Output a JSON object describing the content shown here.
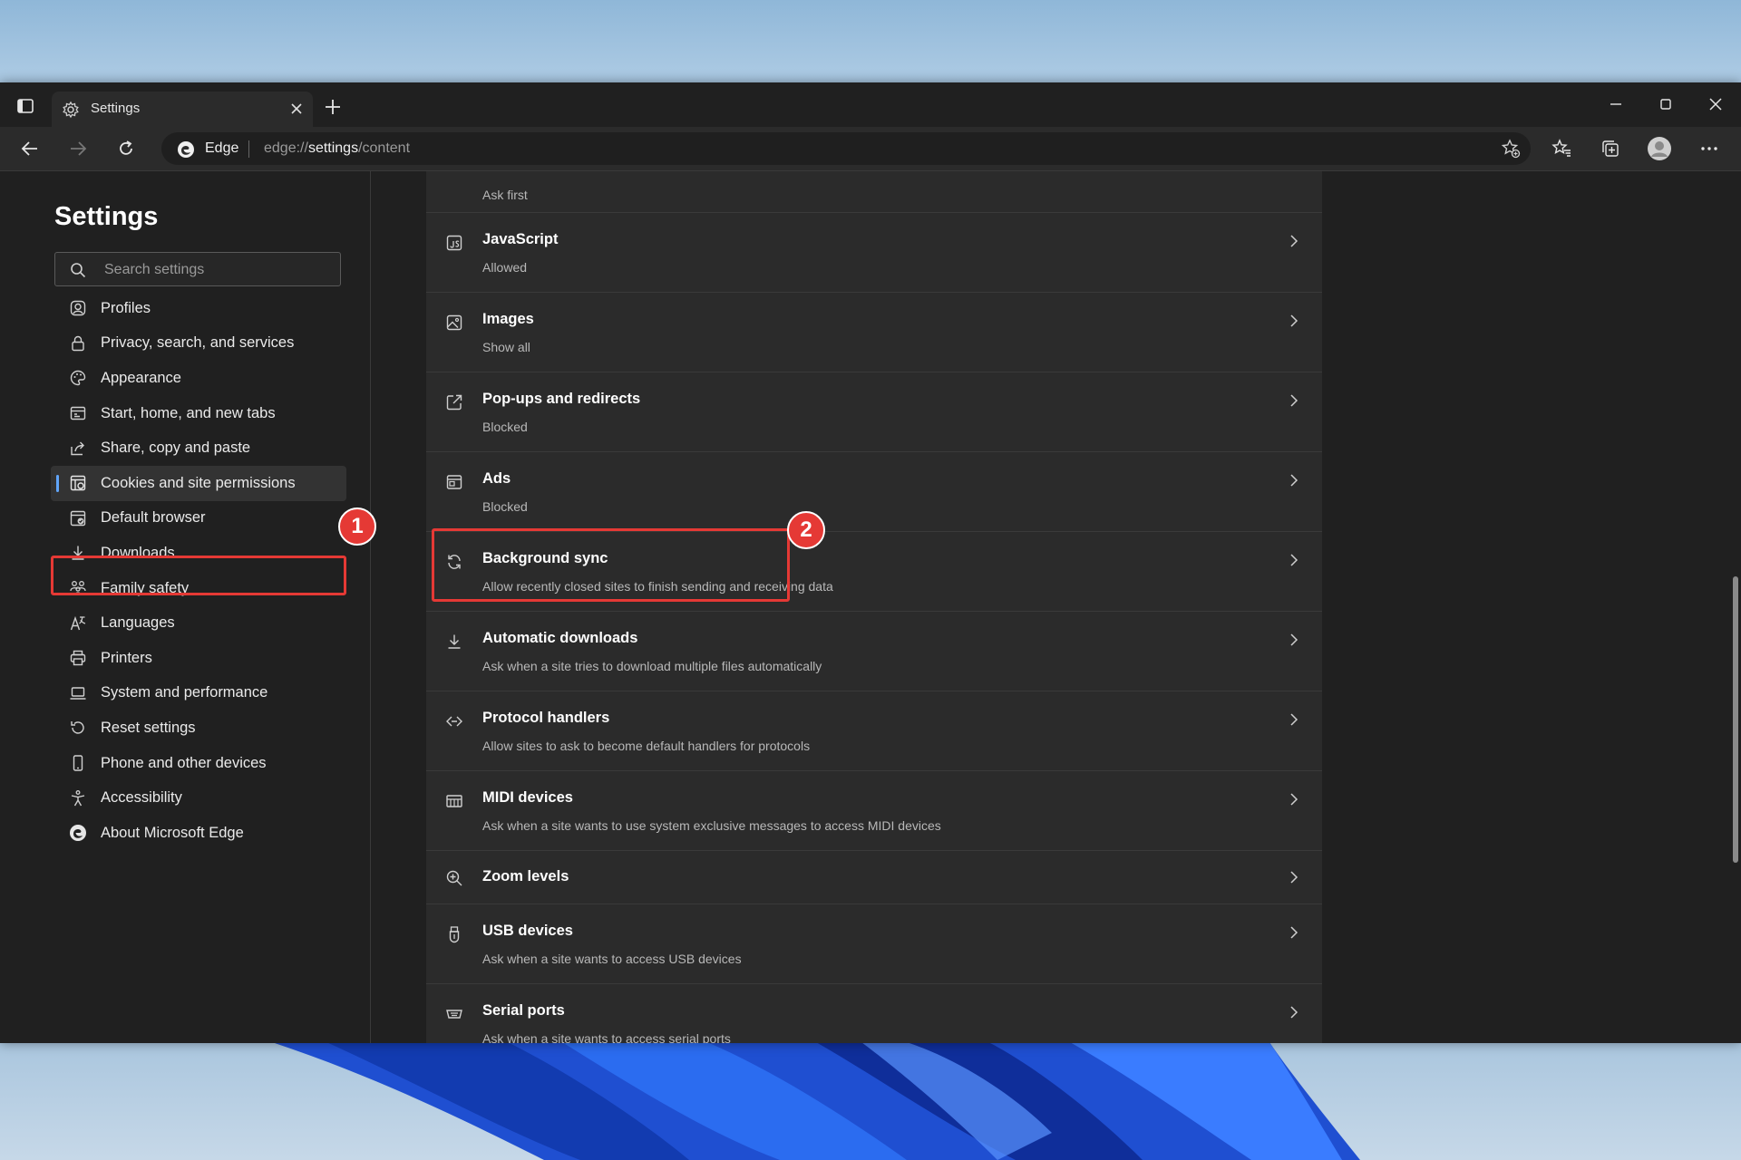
{
  "browser": {
    "tab_title": "Settings",
    "address": {
      "site_label": "Edge",
      "url_prefix": "edge://",
      "url_bold": "settings",
      "url_suffix": "/content"
    }
  },
  "sidebar": {
    "title": "Settings",
    "search_placeholder": "Search settings",
    "items": [
      {
        "label": "Profiles",
        "icon": "profile-icon"
      },
      {
        "label": "Privacy, search, and services",
        "icon": "lock-icon"
      },
      {
        "label": "Appearance",
        "icon": "palette-icon"
      },
      {
        "label": "Start, home, and new tabs",
        "icon": "home-tabs-icon"
      },
      {
        "label": "Share, copy and paste",
        "icon": "share-icon"
      },
      {
        "label": "Cookies and site permissions",
        "icon": "cookies-icon",
        "active": true
      },
      {
        "label": "Default browser",
        "icon": "browser-icon"
      },
      {
        "label": "Downloads",
        "icon": "download-icon"
      },
      {
        "label": "Family safety",
        "icon": "family-icon"
      },
      {
        "label": "Languages",
        "icon": "languages-icon"
      },
      {
        "label": "Printers",
        "icon": "printer-icon"
      },
      {
        "label": "System and performance",
        "icon": "laptop-icon"
      },
      {
        "label": "Reset settings",
        "icon": "reset-icon"
      },
      {
        "label": "Phone and other devices",
        "icon": "phone-icon"
      },
      {
        "label": "Accessibility",
        "icon": "accessibility-icon"
      },
      {
        "label": "About Microsoft Edge",
        "icon": "edge-logo-icon"
      }
    ]
  },
  "content": {
    "rows": [
      {
        "title": "",
        "subtitle": "Ask first",
        "icon": ""
      },
      {
        "title": "JavaScript",
        "subtitle": "Allowed",
        "icon": "javascript-icon"
      },
      {
        "title": "Images",
        "subtitle": "Show all",
        "icon": "image-icon"
      },
      {
        "title": "Pop-ups and redirects",
        "subtitle": "Blocked",
        "icon": "popup-icon"
      },
      {
        "title": "Ads",
        "subtitle": "Blocked",
        "icon": "ads-icon"
      },
      {
        "title": "Background sync",
        "subtitle": "Allow recently closed sites to finish sending and receiving data",
        "icon": "sync-icon"
      },
      {
        "title": "Automatic downloads",
        "subtitle": "Ask when a site tries to download multiple files automatically",
        "icon": "download-icon"
      },
      {
        "title": "Protocol handlers",
        "subtitle": "Allow sites to ask to become default handlers for protocols",
        "icon": "protocol-icon"
      },
      {
        "title": "MIDI devices",
        "subtitle": "Ask when a site wants to use system exclusive messages to access MIDI devices",
        "icon": "midi-icon"
      },
      {
        "title": "Zoom levels",
        "subtitle": "",
        "icon": "zoom-icon"
      },
      {
        "title": "USB devices",
        "subtitle": "Ask when a site wants to access USB devices",
        "icon": "usb-icon"
      },
      {
        "title": "Serial ports",
        "subtitle": "Ask when a site wants to access serial ports",
        "icon": "serial-port-icon"
      }
    ]
  },
  "annotations": {
    "badge_1": "1",
    "badge_2": "2",
    "highlight_color": "#e53935"
  },
  "colors": {
    "window_bg": "#202020",
    "panel_bg": "#2b2b2b",
    "accent": "#60a5fa"
  }
}
